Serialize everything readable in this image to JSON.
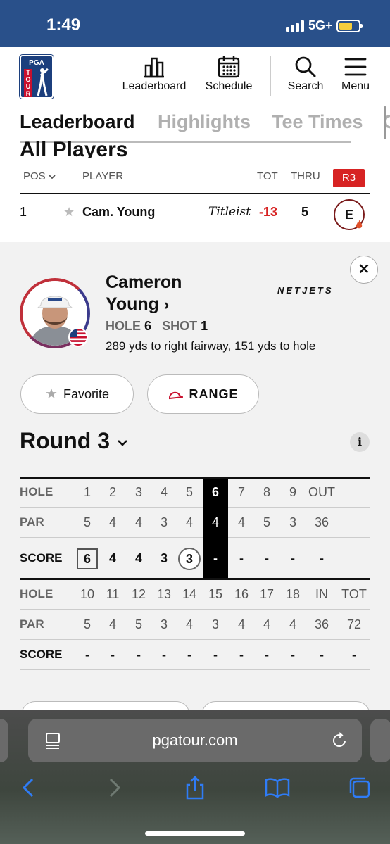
{
  "status_bar": {
    "time": "1:49",
    "network": "5G+"
  },
  "header": {
    "logo": {
      "top": "PGA",
      "side": "TOUR"
    },
    "nav": [
      {
        "label": "Leaderboard",
        "icon": "bar-chart-icon"
      },
      {
        "label": "Schedule",
        "icon": "calendar-icon"
      },
      {
        "label": "Search",
        "icon": "search-icon"
      },
      {
        "label": "Menu",
        "icon": "menu-icon"
      }
    ]
  },
  "tabs": [
    "Leaderboard",
    "Highlights",
    "Tee Times",
    "C"
  ],
  "section_title": "All Players",
  "leaderboard": {
    "columns": {
      "pos": "POS",
      "player": "PLAYER",
      "tot": "TOT",
      "thru": "THRU",
      "round": "R3"
    },
    "row": {
      "pos": "1",
      "player": "Cam. Young",
      "brand": "Titleist",
      "tot": "-13",
      "thru": "5",
      "round_score": "E"
    }
  },
  "player_card": {
    "first_name": "Cameron",
    "last_name": "Young",
    "sponsor": "NETJETS",
    "hole_label": "HOLE",
    "hole": "6",
    "shot_label": "SHOT",
    "shot": "1",
    "shot_description": "289 yds to right fairway, 151 yds to hole",
    "favorite_label": "Favorite",
    "range_label": "RANGE",
    "close_icon": "close-icon"
  },
  "round": {
    "title": "Round 3"
  },
  "scorecard": {
    "front": {
      "hole_label": "HOLE",
      "holes": [
        "1",
        "2",
        "3",
        "4",
        "5",
        "6",
        "7",
        "8",
        "9",
        "OUT"
      ],
      "par_label": "PAR",
      "par": [
        "5",
        "4",
        "4",
        "3",
        "4",
        "4",
        "4",
        "5",
        "3",
        "36"
      ],
      "score_label": "SCORE",
      "score": [
        "6",
        "4",
        "4",
        "3",
        "3",
        "-",
        "-",
        "-",
        "-",
        "-"
      ]
    },
    "back": {
      "hole_label": "HOLE",
      "holes": [
        "10",
        "11",
        "12",
        "13",
        "14",
        "15",
        "16",
        "17",
        "18",
        "IN",
        "TOT"
      ],
      "par_label": "PAR",
      "par": [
        "5",
        "4",
        "5",
        "3",
        "4",
        "3",
        "4",
        "4",
        "4",
        "36",
        "72"
      ],
      "score_label": "SCORE",
      "score": [
        "-",
        "-",
        "-",
        "-",
        "-",
        "-",
        "-",
        "-",
        "-",
        "-",
        "-"
      ]
    },
    "current_hole": "6"
  },
  "browser": {
    "url": "pgatour.com"
  }
}
